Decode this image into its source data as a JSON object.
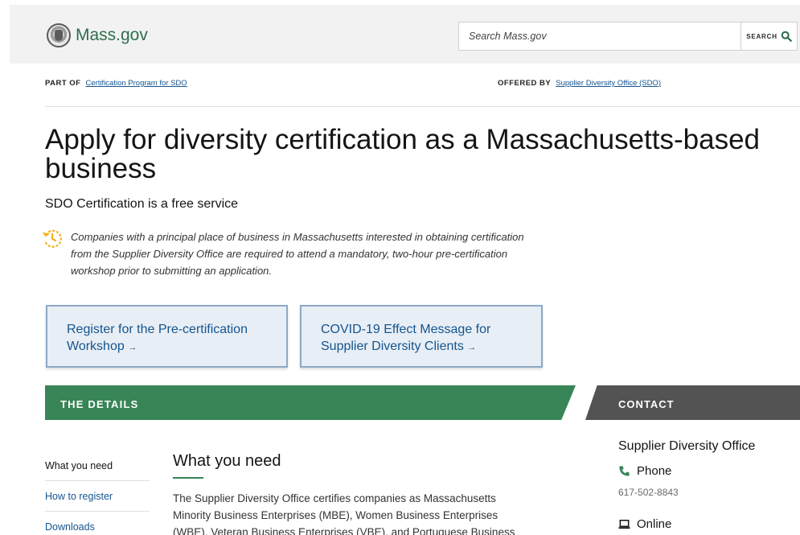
{
  "header": {
    "logo_text": "Mass.gov",
    "search_placeholder": "Search Mass.gov",
    "search_button": "SEARCH"
  },
  "breadcrumb": {
    "part_of_label": "PART OF",
    "part_of_link": "Certification Program for SDO",
    "offered_by_label": "OFFERED BY",
    "offered_by_link": "Supplier Diversity Office (SDO)"
  },
  "page": {
    "title": "Apply for diversity certification as a Massachusetts-based business",
    "subtitle": "SDO Certification is a free service",
    "note": "Companies with a principal place of business in Massachusetts interested in obtaining certification from the Supplier Diversity Office are required to attend a mandatory, two-hour pre-certification workshop prior to submitting an application."
  },
  "ctas": [
    {
      "label": "Register for the Pre-certification Workshop",
      "arrow": "→"
    },
    {
      "label": "COVID-19 Effect Message for Supplier Diversity Clients",
      "arrow": "→"
    }
  ],
  "details": {
    "banner": "THE DETAILS",
    "nav": [
      "What you need",
      "How to register",
      "Downloads"
    ],
    "section_title": "What you need",
    "body": "The Supplier Diversity Office certifies companies as Massachusetts Minority Business Enterprises (MBE), Women Business Enterprises (WBE), Veteran Business Enterprises (VBE), and Portuguese Business"
  },
  "contact": {
    "banner": "CONTACT",
    "org": "Supplier Diversity Office",
    "phone_label": "Phone",
    "phone_value": "617-502-8843",
    "online_label": "Online"
  },
  "colors": {
    "brand_green": "#388557",
    "link_blue": "#14558f",
    "contact_gray": "#535353",
    "cta_bg": "#e8eef5"
  }
}
